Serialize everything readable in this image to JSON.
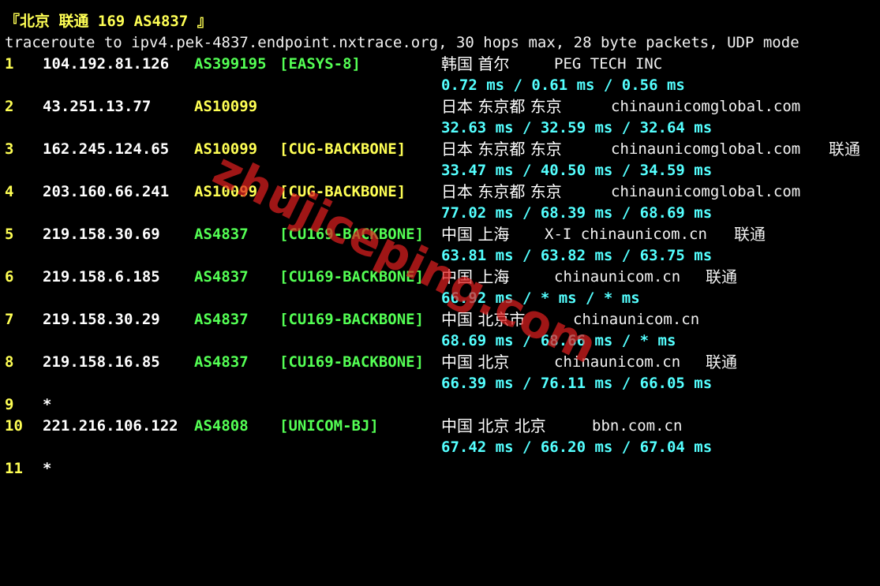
{
  "title": "『北京 联通 169 AS4837 』",
  "command": "traceroute to ipv4.pek-4837.endpoint.nxtrace.org, 30 hops max, 28 byte packets, UDP mode",
  "watermark": "zhujiceping.com",
  "colors": {
    "background": "#000000",
    "hop_number": "#ffff54",
    "ip": "#ffffff",
    "as_yellow": "#ffff54",
    "as_green": "#54ff54",
    "tag_green": "#54ff54",
    "tag_yellow": "#ffff54",
    "rtt": "#54ffff",
    "watermark": "#dc1e1e"
  },
  "hops": [
    {
      "num": "1",
      "ip": "104.192.81.126",
      "asn": "AS399195",
      "tag": "[EASYS-8]",
      "geo": "韩国 首尔",
      "owner": "PEG TECH INC",
      "isp": "",
      "rtt": "0.72 ms / 0.61 ms / 0.56 ms"
    },
    {
      "num": "2",
      "ip": "43.251.13.77",
      "asn": "AS10099",
      "tag": "",
      "geo": "日本 东京都 东京",
      "owner": "chinaunicomglobal.com",
      "isp": "",
      "rtt": "32.63 ms / 32.59 ms / 32.64 ms"
    },
    {
      "num": "3",
      "ip": "162.245.124.65",
      "asn": "AS10099",
      "tag": "[CUG-BACKBONE]",
      "geo": "日本 东京都 东京",
      "owner": "chinaunicomglobal.com",
      "isp": "联通",
      "rtt": "33.47 ms / 40.50 ms / 34.59 ms"
    },
    {
      "num": "4",
      "ip": "203.160.66.241",
      "asn": "AS10099",
      "tag": "[CUG-BACKBONE]",
      "geo": "日本 东京都 东京",
      "owner": "chinaunicomglobal.com",
      "isp": "",
      "rtt": "77.02 ms / 68.39 ms / 68.69 ms"
    },
    {
      "num": "5",
      "ip": "219.158.30.69",
      "asn": "AS4837",
      "tag": "[CU169-BACKBONE]",
      "geo": "中国 上海",
      "owner": "X-I chinaunicom.cn",
      "isp": "联通",
      "rtt": "63.81 ms / 63.82 ms / 63.75 ms"
    },
    {
      "num": "6",
      "ip": "219.158.6.185",
      "asn": "AS4837",
      "tag": "[CU169-BACKBONE]",
      "geo": "中国 上海",
      "owner": "chinaunicom.cn",
      "isp": "联通",
      "rtt": "66.92 ms / * ms / * ms"
    },
    {
      "num": "7",
      "ip": "219.158.30.29",
      "asn": "AS4837",
      "tag": "[CU169-BACKBONE]",
      "geo": "中国 北京市",
      "owner": "chinaunicom.cn",
      "isp": "",
      "rtt": "68.69 ms / 68.66 ms / * ms"
    },
    {
      "num": "8",
      "ip": "219.158.16.85",
      "asn": "AS4837",
      "tag": "[CU169-BACKBONE]",
      "geo": "中国 北京",
      "owner": "chinaunicom.cn",
      "isp": "联通",
      "rtt": "66.39 ms / 76.11 ms / 66.05 ms"
    },
    {
      "num": "9",
      "ip": "*"
    },
    {
      "num": "10",
      "ip": "221.216.106.122",
      "asn": "AS4808",
      "tag": "[UNICOM-BJ]",
      "geo": "中国 北京 北京",
      "owner": "bbn.com.cn",
      "isp": "",
      "rtt": "67.42 ms / 66.20 ms / 67.04 ms"
    },
    {
      "num": "11",
      "ip": "*"
    }
  ]
}
